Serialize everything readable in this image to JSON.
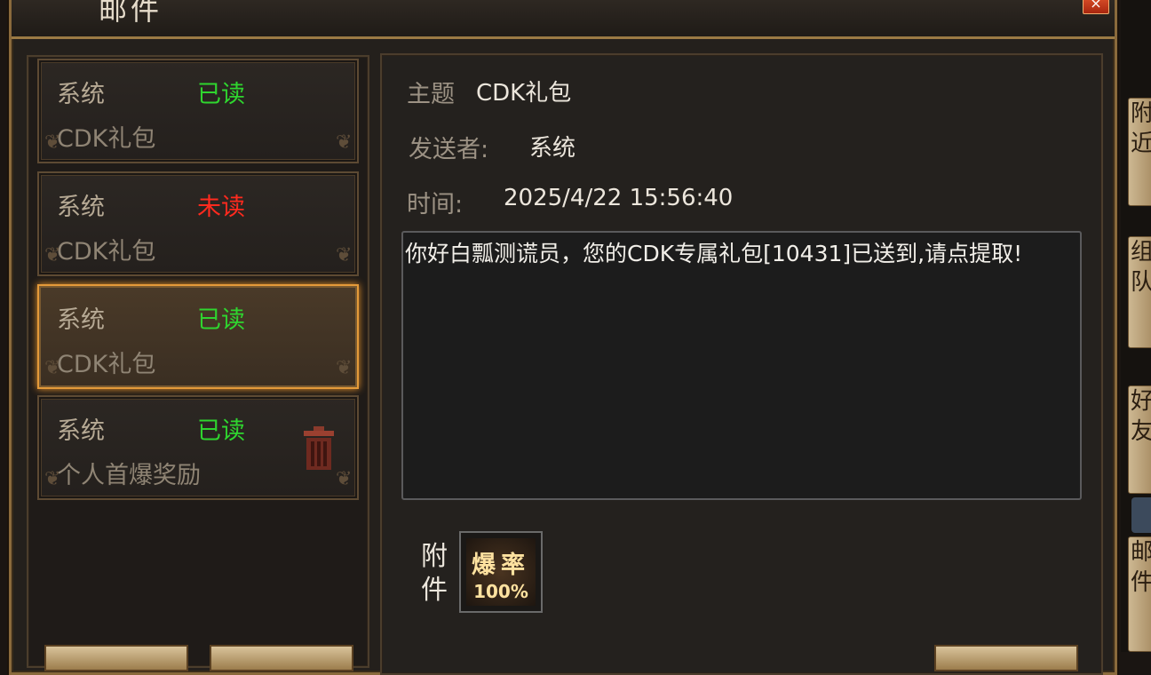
{
  "window": {
    "title": "邮件",
    "close_label": "×"
  },
  "mail_list": [
    {
      "sender": "系统",
      "status": "已读",
      "subject": "CDK礼包"
    },
    {
      "sender": "系统",
      "status": "未读",
      "subject": "CDK礼包"
    },
    {
      "sender": "系统",
      "status": "已读",
      "subject": "CDK礼包"
    },
    {
      "sender": "系统",
      "status": "已读",
      "subject": "个人首爆奖励"
    }
  ],
  "detail": {
    "subject_label": "主题",
    "subject_value": "CDK礼包",
    "sender_label": "发送者:",
    "sender_value": "系统",
    "time_label": "时间:",
    "time_value": "2025/4/22 15:56:40",
    "body": "你好白瓢测谎员，您的CDK专属礼包[10431]已送到,请点提取!",
    "attachment_label_1": "附",
    "attachment_label_2": "件",
    "attachment_item_top": "爆率",
    "attachment_item_bottom": "100%"
  },
  "side_tabs": [
    {
      "label": "附近"
    },
    {
      "label": "组队"
    },
    {
      "label": "好友"
    },
    {
      "label": "邮件"
    }
  ],
  "colors": {
    "read": "#2fd52f",
    "unread": "#ff2a1e",
    "selected_border": "#e49a3a",
    "frame_gold": "#8a6a3c"
  },
  "icons": {
    "trash": "trash-icon",
    "close": "close-icon"
  }
}
